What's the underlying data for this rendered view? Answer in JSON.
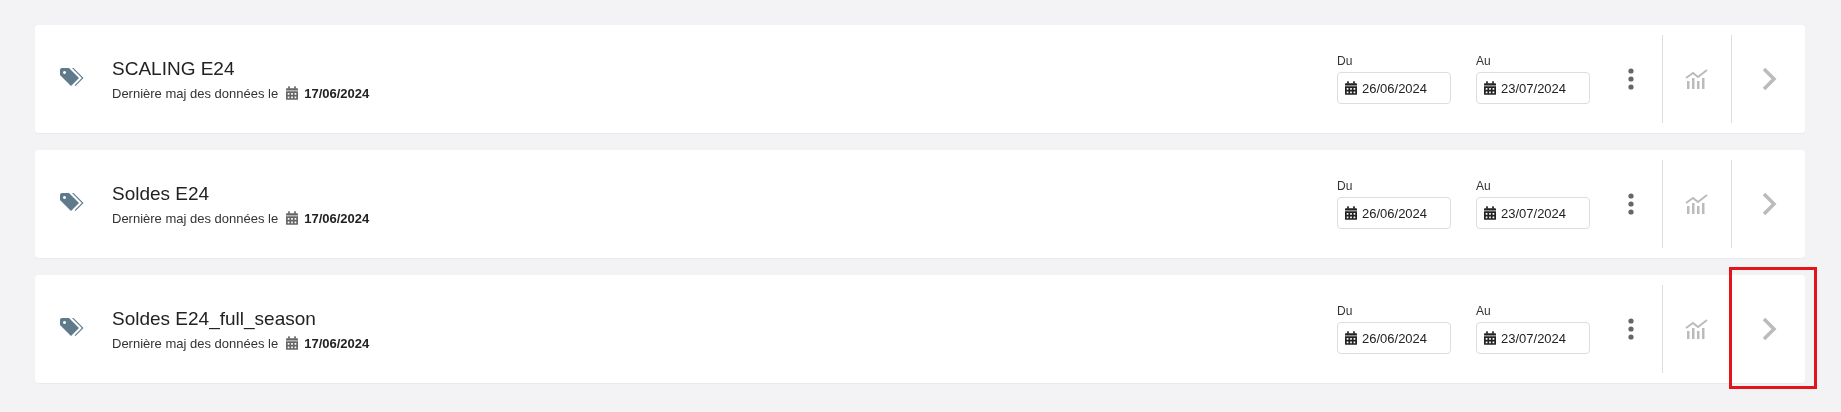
{
  "campaigns": [
    {
      "title": "SCALING E24",
      "updated_label": "Dernière maj des données le",
      "updated_date": "17/06/2024",
      "from_label": "Du",
      "from_date": "26/06/2024",
      "to_label": "Au",
      "to_date": "23/07/2024",
      "highlighted": false
    },
    {
      "title": "Soldes E24",
      "updated_label": "Dernière maj des données le",
      "updated_date": "17/06/2024",
      "from_label": "Du",
      "from_date": "26/06/2024",
      "to_label": "Au",
      "to_date": "23/07/2024",
      "highlighted": false
    },
    {
      "title": "Soldes E24_full_season",
      "updated_label": "Dernière maj des données le",
      "updated_date": "17/06/2024",
      "from_label": "Du",
      "from_date": "26/06/2024",
      "to_label": "Au",
      "to_date": "23/07/2024",
      "highlighted": true
    }
  ]
}
